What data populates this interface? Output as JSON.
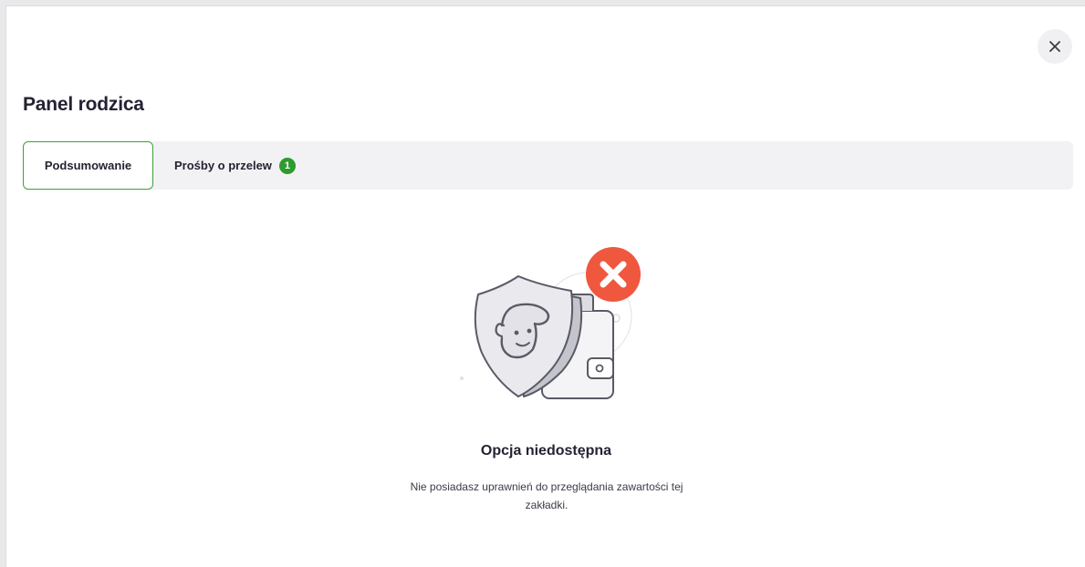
{
  "modal": {
    "close_icon": "close-icon",
    "title": "Panel rodzica"
  },
  "tabs": [
    {
      "label": "Podsumowanie",
      "active": true
    },
    {
      "label": "Prośby o przelew",
      "badge": "1",
      "active": false
    }
  ],
  "empty_state": {
    "illustration": "shield-wallet-denied-illustration",
    "title": "Opcja niedostępna",
    "text": "Nie posiadasz uprawnień do przeglądania zawartości tej zakładki."
  },
  "colors": {
    "accent_green": "#3aa33a",
    "badge_green": "#2e9b2e",
    "error_red": "#f0573f",
    "tabbar_bg": "#f2f2f4"
  }
}
